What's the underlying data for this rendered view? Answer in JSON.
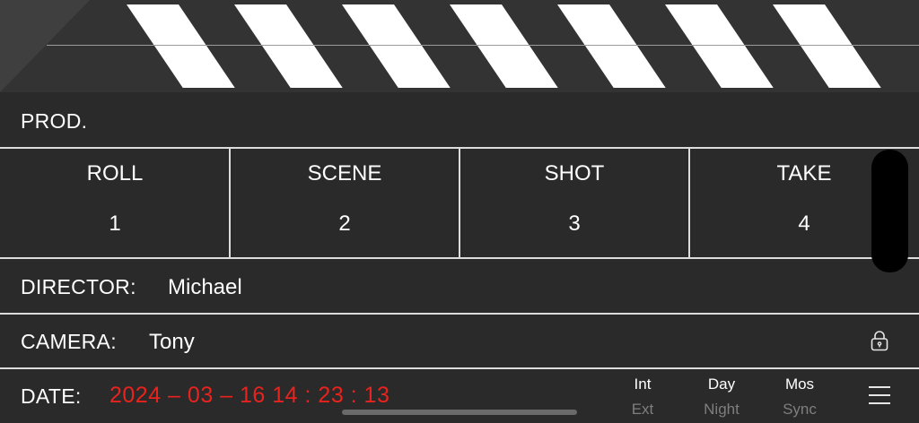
{
  "header": {
    "prod_label": "PROD."
  },
  "slate_cells": [
    {
      "title": "ROLL",
      "value": "1"
    },
    {
      "title": "SCENE",
      "value": "2"
    },
    {
      "title": "SHOT",
      "value": "3"
    },
    {
      "title": "TAKE",
      "value": "4"
    }
  ],
  "director": {
    "label": "DIRECTOR:",
    "value": "Michael"
  },
  "camera": {
    "label": "CAMERA:",
    "value": "Tony"
  },
  "date": {
    "label": "DATE:",
    "value": "2024 – 03 – 16   14 : 23 : 13"
  },
  "toggles": [
    {
      "on": "Int",
      "off": "Ext"
    },
    {
      "on": "Day",
      "off": "Night"
    },
    {
      "on": "Mos",
      "off": "Sync"
    }
  ],
  "icons": {
    "lock": "lock-icon",
    "menu": "menu-icon"
  },
  "colors": {
    "background": "#2a2a2a",
    "date_text": "#e8231e",
    "inactive_text": "#7e7e7e",
    "stripe": "#ffffff"
  }
}
